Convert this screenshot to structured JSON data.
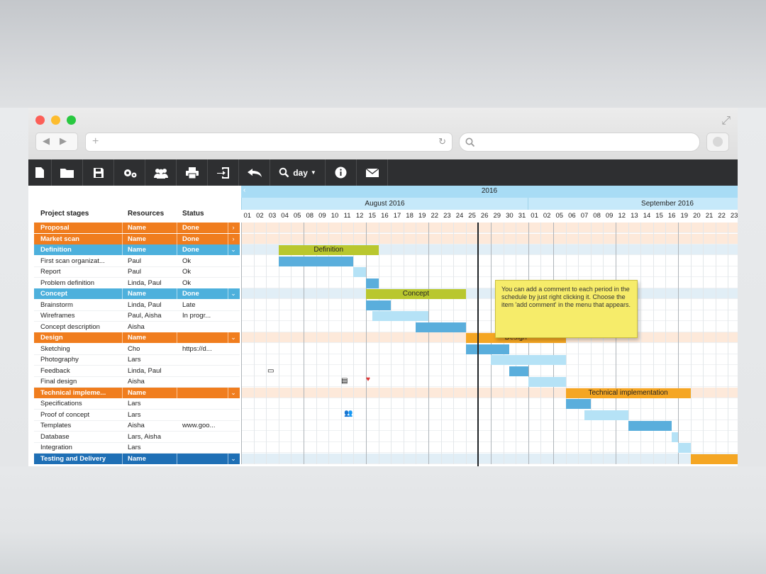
{
  "toolbar": {
    "zoom_label": "day"
  },
  "left_panel": {
    "headers": {
      "stage": "Project stages",
      "resources": "Resources",
      "status": "Status"
    },
    "rows": [
      {
        "type": "group",
        "color": "#f07d1e",
        "stage": "Proposal",
        "resources": "Name",
        "status": "Done",
        "chevron": "›"
      },
      {
        "type": "group",
        "color": "#f07d1e",
        "stage": "Market scan",
        "resources": "Name",
        "status": "Done",
        "chevron": "›"
      },
      {
        "type": "group",
        "color": "#4db0dc",
        "stage": "Definition",
        "resources": "Name",
        "status": "Done",
        "chevron": "⌄"
      },
      {
        "type": "task",
        "stage": "First scan organizat...",
        "resources": "Paul",
        "status": "Ok"
      },
      {
        "type": "task",
        "stage": "Report",
        "resources": "Paul",
        "status": "Ok"
      },
      {
        "type": "task",
        "stage": "Problem definition",
        "resources": "Linda, Paul",
        "status": "Ok"
      },
      {
        "type": "group",
        "color": "#4db0dc",
        "stage": "Concept",
        "resources": "Name",
        "status": "Done",
        "chevron": "⌄"
      },
      {
        "type": "task",
        "stage": "Brainstorm",
        "resources": "Linda, Paul",
        "status": "Late"
      },
      {
        "type": "task",
        "stage": "Wireframes",
        "resources": "Paul, Aisha",
        "status": "In progr..."
      },
      {
        "type": "task",
        "stage": "Concept description",
        "resources": "Aisha",
        "status": ""
      },
      {
        "type": "group",
        "color": "#f07d1e",
        "stage": "Design",
        "resources": "Name",
        "status": "",
        "chevron": "⌄"
      },
      {
        "type": "task",
        "stage": "Sketching",
        "resources": "Cho",
        "status": "https://d..."
      },
      {
        "type": "task",
        "stage": "Photography",
        "resources": "Lars",
        "status": ""
      },
      {
        "type": "task",
        "stage": "Feedback",
        "resources": "Linda, Paul",
        "status": ""
      },
      {
        "type": "task",
        "stage": "Final design",
        "resources": "Aisha",
        "status": ""
      },
      {
        "type": "group",
        "color": "#f07d1e",
        "stage": "Technical impleme...",
        "resources": "Name",
        "status": "",
        "chevron": "⌄"
      },
      {
        "type": "task",
        "stage": "Specifications",
        "resources": "Lars",
        "status": ""
      },
      {
        "type": "task",
        "stage": "Proof of concept",
        "resources": "Lars",
        "status": ""
      },
      {
        "type": "task",
        "stage": "Templates",
        "resources": "Aisha",
        "status": "www.goo..."
      },
      {
        "type": "task",
        "stage": "Database",
        "resources": "Lars, Aisha",
        "status": ""
      },
      {
        "type": "task",
        "stage": "Integration",
        "resources": "Lars",
        "status": ""
      },
      {
        "type": "group",
        "color": "#1e6fb5",
        "stage": "Testing and Delivery",
        "resources": "Name",
        "status": "",
        "chevron": "⌄"
      }
    ]
  },
  "timeline": {
    "year": "2016",
    "months": [
      {
        "label": "August 2016"
      },
      {
        "label": "September 2016"
      }
    ],
    "days": [
      "01",
      "02",
      "03",
      "04",
      "05",
      "08",
      "09",
      "10",
      "11",
      "12",
      "15",
      "16",
      "17",
      "18",
      "19",
      "22",
      "23",
      "24",
      "25",
      "26",
      "29",
      "30",
      "31",
      "01",
      "02",
      "05",
      "06",
      "07",
      "08",
      "09",
      "12",
      "13",
      "14",
      "15",
      "16",
      "19",
      "20",
      "21",
      "22",
      "23"
    ],
    "today_day": "26",
    "colors": {
      "group_orange": "#f5a623",
      "group_green": "#b9c72e",
      "task_blue": "#5aaedc",
      "task_light": "#b5e2f6",
      "shade_orange": "#fde9da",
      "shade_blue": "#e1eef6"
    },
    "bars": [
      {
        "row": 2,
        "start": 3,
        "end": 11,
        "kind": "group_green",
        "label": "Definition"
      },
      {
        "row": 3,
        "start": 3,
        "end": 9,
        "kind": "task_blue",
        "label": ""
      },
      {
        "row": 4,
        "start": 9,
        "end": 10,
        "kind": "task_light",
        "label": ""
      },
      {
        "row": 5,
        "start": 10,
        "end": 11,
        "kind": "task_blue",
        "label": ""
      },
      {
        "row": 6,
        "start": 10,
        "end": 18,
        "kind": "group_green",
        "label": "Concept"
      },
      {
        "row": 7,
        "start": 10,
        "end": 12,
        "kind": "task_blue",
        "label": ""
      },
      {
        "row": 8,
        "start": 10.5,
        "end": 15,
        "kind": "task_light",
        "label": ""
      },
      {
        "row": 9,
        "start": 14,
        "end": 18,
        "kind": "task_blue",
        "label": ""
      },
      {
        "row": 10,
        "start": 18,
        "end": 26,
        "kind": "group_orange",
        "label": "Design"
      },
      {
        "row": 11,
        "start": 18,
        "end": 21.5,
        "kind": "task_blue",
        "label": ""
      },
      {
        "row": 12,
        "start": 20,
        "end": 26,
        "kind": "task_light",
        "label": ""
      },
      {
        "row": 13,
        "start": 21.5,
        "end": 23,
        "kind": "task_blue",
        "label": ""
      },
      {
        "row": 14,
        "start": 23,
        "end": 26,
        "kind": "task_light",
        "label": ""
      },
      {
        "row": 15,
        "start": 26,
        "end": 36,
        "kind": "group_orange",
        "label": "Technical implementation"
      },
      {
        "row": 16,
        "start": 26,
        "end": 28,
        "kind": "task_blue",
        "label": ""
      },
      {
        "row": 17,
        "start": 27.5,
        "end": 31,
        "kind": "task_light",
        "label": ""
      },
      {
        "row": 18,
        "start": 31,
        "end": 34.5,
        "kind": "task_blue",
        "label": ""
      },
      {
        "row": 19,
        "start": 34.5,
        "end": 35,
        "kind": "task_light",
        "label": ""
      },
      {
        "row": 20,
        "start": 35,
        "end": 36,
        "kind": "task_light",
        "label": ""
      },
      {
        "row": 21,
        "start": 36,
        "end": 40,
        "kind": "group_orange",
        "label": ""
      }
    ]
  },
  "tooltip": {
    "text": "You can add a comment to each period in the schedule by just right clicking it. Choose the item 'add comment' in the menu that appears."
  }
}
